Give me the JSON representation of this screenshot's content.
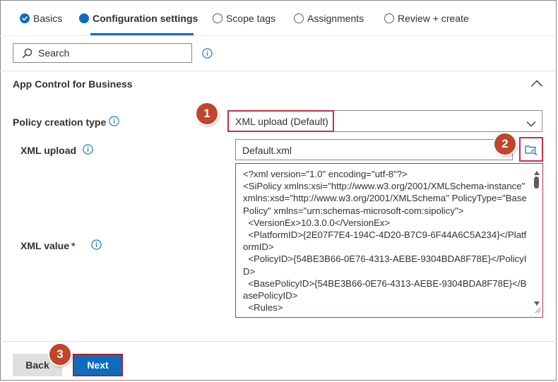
{
  "wizard": {
    "steps": [
      {
        "label": "Basics",
        "state": "done"
      },
      {
        "label": "Configuration settings",
        "state": "current"
      },
      {
        "label": "Scope tags",
        "state": "todo"
      },
      {
        "label": "Assignments",
        "state": "todo"
      },
      {
        "label": "Review + create",
        "state": "todo"
      }
    ]
  },
  "search": {
    "placeholder": "Search"
  },
  "section": {
    "title": "App Control for Business"
  },
  "form": {
    "policy_type_label": "Policy creation type",
    "policy_type_value": "XML upload (Default)",
    "xml_upload_label": "XML upload",
    "xml_upload_value": "Default.xml",
    "xml_value_label": "XML value",
    "required_mark": "*",
    "xml_value_text": "<?xml version=\"1.0\" encoding=\"utf-8\"?>\n<SiPolicy xmlns:xsi=\"http://www.w3.org/2001/XMLSchema-instance\" xmlns:xsd=\"http://www.w3.org/2001/XMLSchema\" PolicyType=\"Base Policy\" xmlns=\"urn:schemas-microsoft-com:sipolicy\">\n  <VersionEx>10.3.0.0</VersionEx>\n  <PlatformID>{2E07F7E4-194C-4D20-B7C9-6F44A6C5A234}</PlatformID>\n  <PolicyID>{54BE3B66-0E76-4313-AEBE-9304BDA8F78E}</PolicyID>\n  <BasePolicyID>{54BE3B66-0E76-4313-AEBE-9304BDA8F78E}</BasePolicyID>\n  <Rules>"
  },
  "footer": {
    "back_label": "Back",
    "next_label": "Next"
  },
  "callouts": [
    "1",
    "2",
    "3"
  ],
  "colors": {
    "accent": "#0f6cbd",
    "highlight": "#c4314b",
    "badge": "#c0452a"
  }
}
